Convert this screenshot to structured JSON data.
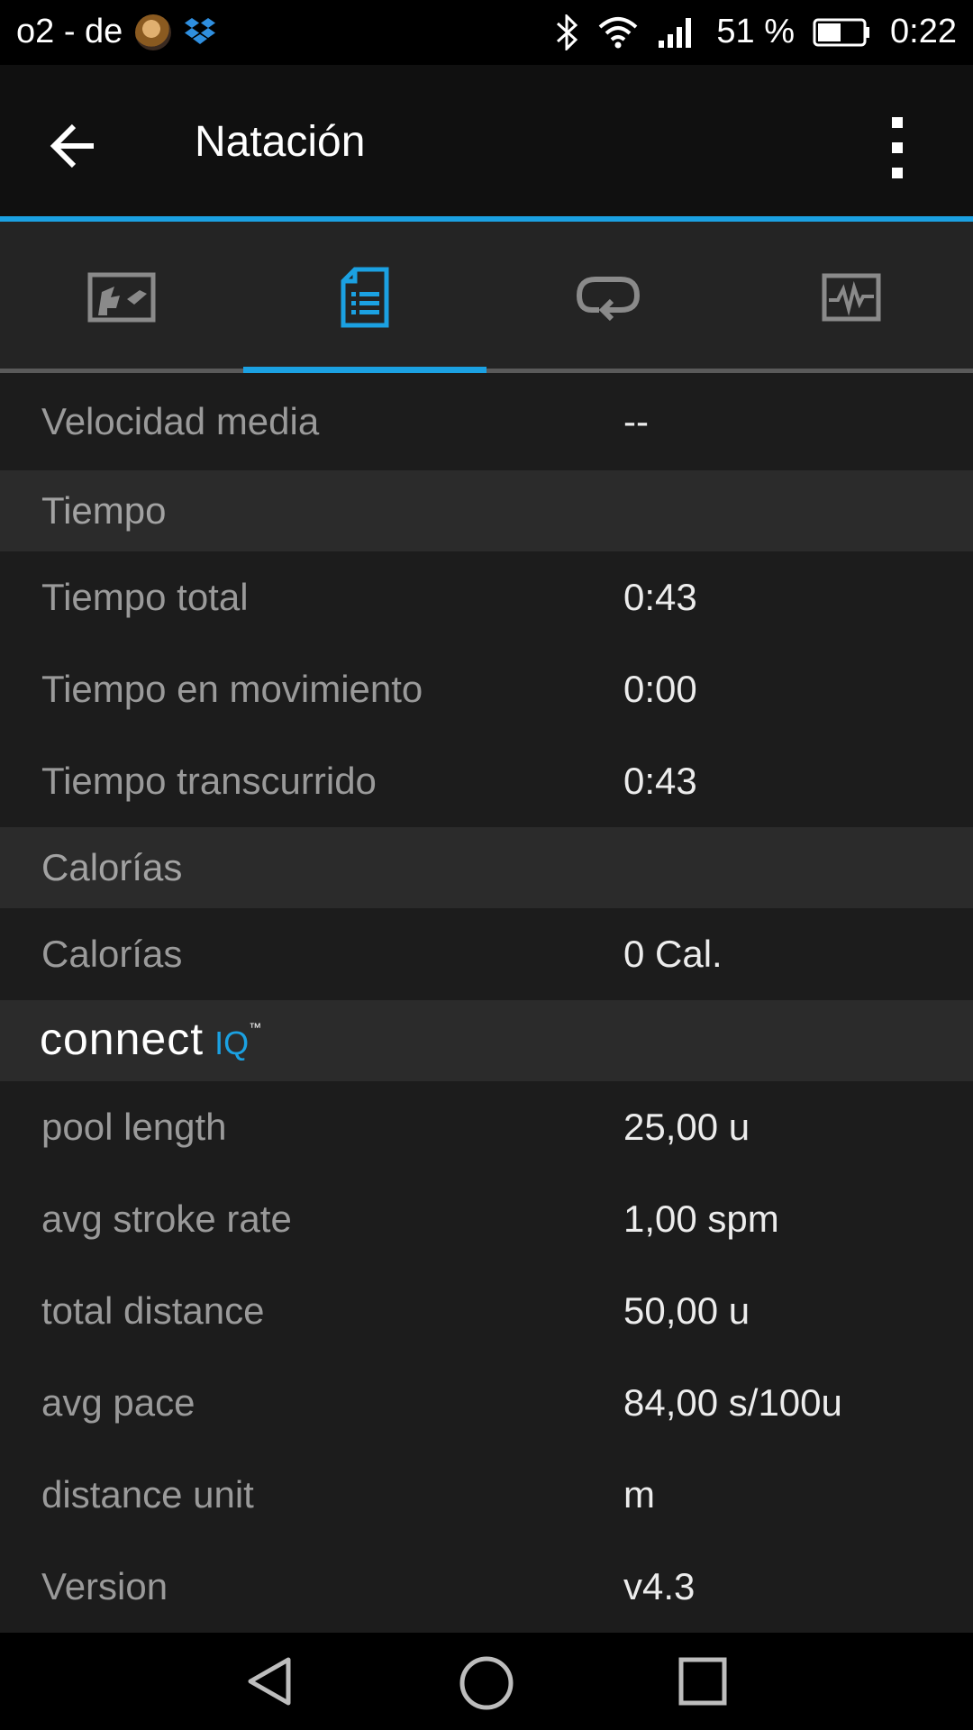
{
  "status_bar": {
    "carrier": "o2 - de",
    "battery_percent": "51 %",
    "time": "0:22",
    "icons": [
      "avatar-icon",
      "dropbox-icon",
      "bluetooth-icon",
      "wifi-icon",
      "signal-icon",
      "battery-icon"
    ]
  },
  "app_bar": {
    "title": "Natación",
    "back_icon": "arrow-left-icon",
    "menu_icon": "more-vert-icon"
  },
  "tabs": {
    "items": [
      {
        "icon": "map-icon",
        "selected": false
      },
      {
        "icon": "document-list-icon",
        "selected": true
      },
      {
        "icon": "loop-icon",
        "selected": false
      },
      {
        "icon": "chart-icon",
        "selected": false
      }
    ],
    "accent_color": "#1ba1e2"
  },
  "details": {
    "avg_speed": {
      "label": "Velocidad media",
      "value": "--"
    },
    "time_section": "Tiempo",
    "total_time": {
      "label": "Tiempo total",
      "value": "0:43"
    },
    "moving_time": {
      "label": "Tiempo en movimiento",
      "value": "0:00"
    },
    "elapsed_time": {
      "label": "Tiempo transcurrido",
      "value": "0:43"
    },
    "calories_section": "Calorías",
    "calories": {
      "label": "Calorías",
      "value": "0 Cal."
    },
    "connect_iq": {
      "word": "connect",
      "suffix": "IQ",
      "trademark": "™"
    },
    "pool_length": {
      "label": "pool length",
      "value": "25,00 u"
    },
    "avg_stroke_rate": {
      "label": "avg stroke rate",
      "value": "1,00 spm"
    },
    "total_distance": {
      "label": "total distance",
      "value": "50,00 u"
    },
    "avg_pace": {
      "label": "avg pace",
      "value": "84,00 s/100u"
    },
    "distance_unit": {
      "label": "distance unit",
      "value": "m"
    },
    "version": {
      "label": "Version",
      "value": "v4.3"
    }
  },
  "nav_bar": {
    "icons": [
      "back-triangle-icon",
      "home-circle-icon",
      "recents-square-icon"
    ]
  }
}
